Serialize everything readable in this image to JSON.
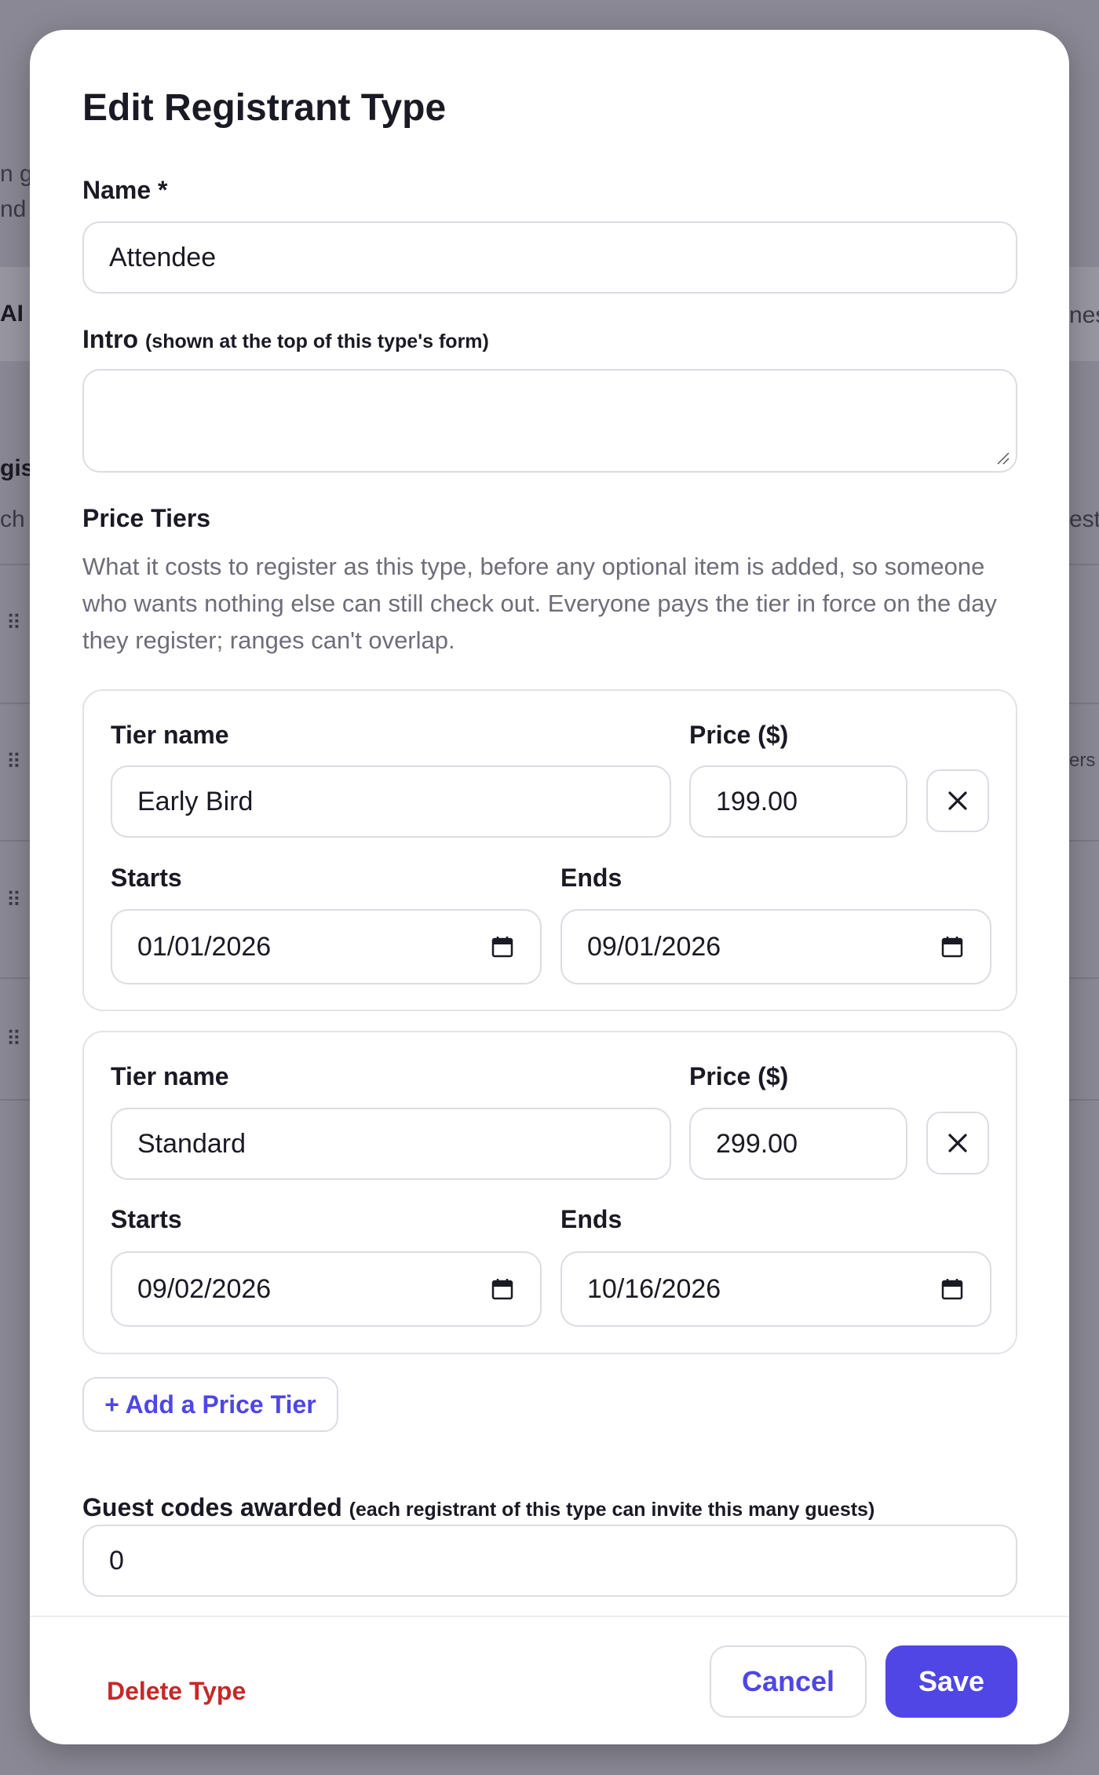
{
  "background": {
    "fragments": [
      "n g",
      "nd p",
      "AI",
      "gis",
      "ch p",
      "nes",
      "est",
      "ers"
    ]
  },
  "modal": {
    "title": "Edit Registrant Type",
    "name_label": "Name *",
    "name_value": "Attendee",
    "intro_label": "Intro",
    "intro_hint": "(shown at the top of this type's form)",
    "intro_value": "",
    "price_tiers_label": "Price Tiers",
    "price_tiers_help": "What it costs to register as this type, before any optional item is added, so someone who wants nothing else can still check out. Everyone pays the tier in force on the day they register; ranges can't overlap.",
    "tiers": [
      {
        "tier_name_label": "Tier name",
        "tier_name": "Early Bird",
        "price_label": "Price ($)",
        "price": "199.00",
        "starts_label": "Starts",
        "starts": "01/01/2026",
        "ends_label": "Ends",
        "ends": "09/01/2026"
      },
      {
        "tier_name_label": "Tier name",
        "tier_name": "Standard",
        "price_label": "Price ($)",
        "price": "299.00",
        "starts_label": "Starts",
        "starts": "09/02/2026",
        "ends_label": "Ends",
        "ends": "10/16/2026"
      }
    ],
    "add_tier_label": "+ Add a Price Tier",
    "guest_codes_label": "Guest codes awarded",
    "guest_codes_hint": "(each registrant of this type can invite this many guests)",
    "guest_codes_value": "0",
    "delete_label": "Delete Type",
    "cancel_label": "Cancel",
    "save_label": "Save"
  },
  "colors": {
    "accent": "#4f46e5",
    "danger": "#c62828",
    "overlay": "#8a8894"
  },
  "icons": {
    "remove": "close-icon",
    "date": "calendar-icon",
    "drag": "drag-handle-icon"
  }
}
